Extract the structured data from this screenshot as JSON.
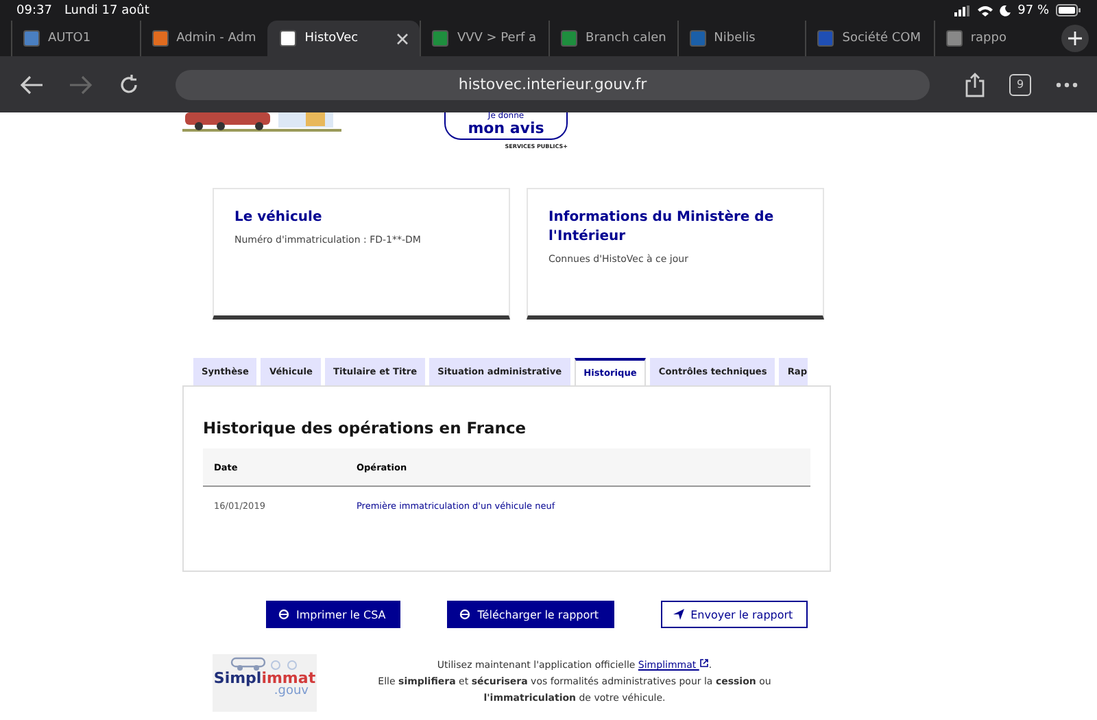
{
  "status_bar": {
    "time": "09:37",
    "date": "Lundi 17 août",
    "battery": "97 %"
  },
  "browser_tabs": [
    {
      "title": "AUTO1",
      "kind": "auto1",
      "selected": false
    },
    {
      "title": "Admin - Adm",
      "kind": "admin",
      "selected": false
    },
    {
      "title": "HistoVec",
      "kind": "histovec",
      "selected": true
    },
    {
      "title": "VVV > Perf a",
      "kind": "sheet",
      "selected": false
    },
    {
      "title": "Branch calen",
      "kind": "sheet",
      "selected": false
    },
    {
      "title": "Nibelis",
      "kind": "nibelis",
      "selected": false
    },
    {
      "title": "Société COM",
      "kind": "letter",
      "selected": false
    },
    {
      "title": "rappo",
      "kind": "globe",
      "selected": false
    }
  ],
  "address_bar": {
    "url": "histovec.interieur.gouv.fr",
    "tab_count": "9"
  },
  "banner": {
    "avis_line_1": "Je donne",
    "avis_line_2": "mon avis",
    "services_publics": "SERVICES PUBLICS+"
  },
  "cards": [
    {
      "title": "Le véhicule",
      "text": "Numéro d'immatriculation : FD-1**-DM"
    },
    {
      "title": "Informations du Ministère de l'Intérieur",
      "text": "Connues d'HistoVec à ce jour"
    }
  ],
  "tabs": [
    {
      "label": "Synthèse",
      "selected": false
    },
    {
      "label": "Véhicule",
      "selected": false
    },
    {
      "label": "Titulaire et Titre",
      "selected": false
    },
    {
      "label": "Situation administrative",
      "selected": false
    },
    {
      "label": "Historique",
      "selected": true
    },
    {
      "label": "Contrôles techniques",
      "selected": false
    },
    {
      "label": "Rap",
      "selected": false
    }
  ],
  "panel": {
    "title": "Historique des opérations en France",
    "table": {
      "columns": [
        "Date",
        "Opération"
      ],
      "rows": [
        [
          "16/01/2019",
          "Première immatriculation d'un véhicule neuf"
        ]
      ]
    }
  },
  "buttons": [
    {
      "label": "Imprimer le CSA",
      "kind": "print"
    },
    {
      "label": "Télécharger le rapport",
      "kind": "download"
    },
    {
      "label": "Envoyer le rapport",
      "kind": "send"
    }
  ],
  "footer": {
    "logo": {
      "part_1": "Simpl",
      "part_2": "immat",
      "suffix": ".gouv"
    },
    "line_1": "Utilisez maintenant l'application officielle",
    "link": "Simplimmat",
    "line_1_end": ".",
    "line_2": "Elle **simplifiera** et **sécurisera** vos formalités administratives pour la **cession** ou **l'immatriculation** de votre véhicule."
  }
}
